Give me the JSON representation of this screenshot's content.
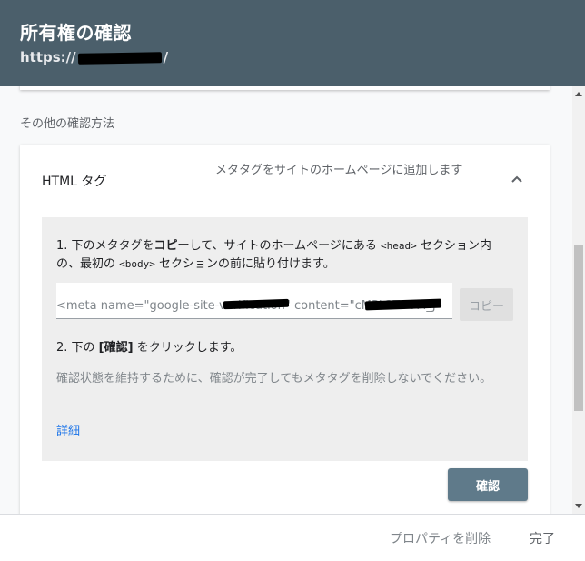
{
  "header": {
    "title": "所有権の確認",
    "url_prefix": "https://",
    "url_suffix": "/"
  },
  "section_label": "その他の確認方法",
  "method": {
    "title": "HTML タグ",
    "description": "メタタグをサイトのホームページに追加します",
    "collapse_icon": "chevron-up-icon"
  },
  "instructions": {
    "step1_prefix": "1. 下のメタタグを",
    "step1_bold": "コピー",
    "step1_mid": "して、サイトのホームページにある ",
    "step1_code1": "<head>",
    "step1_mid2": " セクション内の、最初の ",
    "step1_code2": "<body>",
    "step1_suffix": " セクションの前に貼り付けます。",
    "meta_tag_value": "<meta name=\"google-site-verification\" content=\"cMPL3TS-X-I_J",
    "copy_label": "コピー",
    "step2_prefix": "2. 下の ",
    "step2_bold": "[確認]",
    "step2_suffix": " をクリックします。",
    "note": "確認状態を維持するために、確認が完了してもメタタグを削除しないでください。",
    "details_link": "詳細"
  },
  "verify_label": "確認",
  "footer": {
    "remove_property": "プロパティを削除",
    "done": "完了"
  },
  "colors": {
    "header_bg": "#4b5f6b",
    "verify_bg": "#5f7a8a",
    "link": "#1a73e8"
  }
}
